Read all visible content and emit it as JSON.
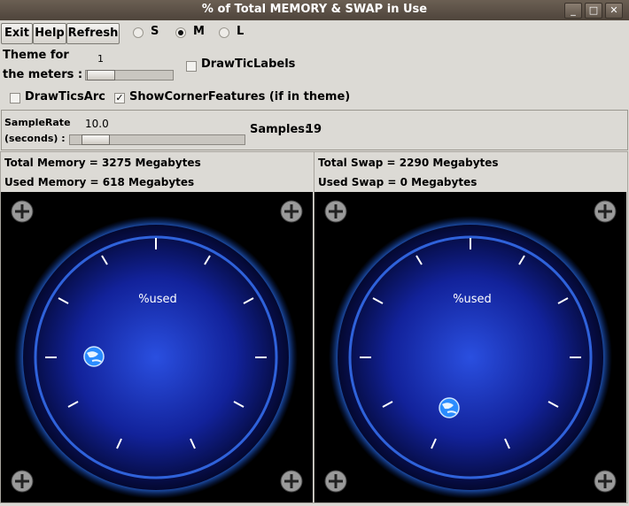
{
  "window": {
    "title": "% of Total MEMORY & SWAP in Use"
  },
  "toolbar": {
    "exit_label": "Exit",
    "help_label": "Help",
    "refresh_label": "Refresh"
  },
  "size_options": [
    {
      "label": "S",
      "selected": false
    },
    {
      "label": "M",
      "selected": true
    },
    {
      "label": "L",
      "selected": false
    }
  ],
  "theme": {
    "label_line1": "Theme for",
    "label_line2": "the meters :",
    "value": "1"
  },
  "checkboxes": {
    "draw_tic_labels": {
      "label": "DrawTicLabels",
      "checked": false
    },
    "draw_tics_arc": {
      "label": "DrawTicsArc",
      "checked": false
    },
    "show_corner_features": {
      "label": "ShowCornerFeatures (if in theme)",
      "checked": true
    }
  },
  "sample": {
    "rate_label1": "SampleRate",
    "rate_label2": "(seconds) :",
    "rate_value": "10.0",
    "samples_label": "Samples:",
    "samples_value": "19"
  },
  "memory": {
    "total_text": "Total Memory = 3275 Megabytes",
    "used_text": "Used Memory = 618 Megabytes",
    "dial_label": "%used"
  },
  "swap": {
    "total_text": "Total Swap = 2290 Megabytes",
    "used_text": "Used Swap = 0 Megabytes",
    "dial_label": "%used"
  }
}
